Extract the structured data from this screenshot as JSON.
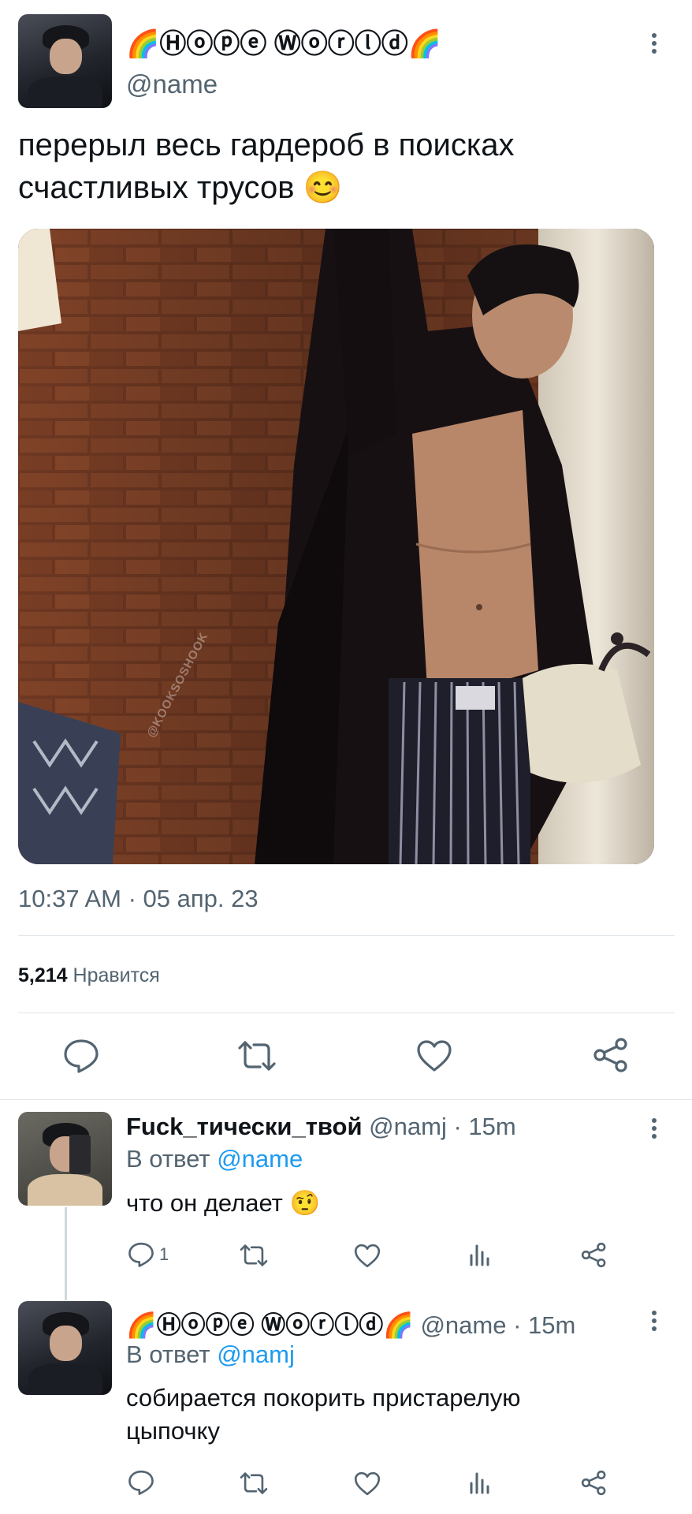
{
  "tweet": {
    "display_name": "🌈Ⓗⓞⓟⓔ Ⓦⓞⓡⓛⓓ🌈",
    "handle": "@name",
    "text_line1": "перерыл весь гардероб в поисках",
    "text_line2": "счастливых трусов 😊",
    "image_watermark": "@KOOKSOSHOOK",
    "timestamp": "10:37 AM · 05 апр. 23",
    "likes_count": "5,214",
    "likes_label": "Нравится"
  },
  "replies": [
    {
      "display_name": "Fuck_тически_твой",
      "handle": "@namj",
      "time": "· 15m",
      "reply_to_label": "В ответ",
      "reply_to_handle": "@name",
      "text_line1": "что он делает 🤨",
      "text_line2": "",
      "reply_count": "1"
    },
    {
      "display_name": "🌈Ⓗⓞⓟⓔ Ⓦⓞⓡⓛⓓ🌈",
      "handle": "@name",
      "time": "· 15m",
      "reply_to_label": "В ответ",
      "reply_to_handle": "@namj",
      "text_line1": "собирается покорить пристарелую",
      "text_line2": "цыпочку",
      "reply_count": ""
    }
  ],
  "icons": {
    "reply": "speech-bubble",
    "retweet": "retweet-arrows",
    "like": "heart",
    "views": "bar-chart",
    "share": "share-nodes",
    "more": "vertical-dots"
  },
  "colors": {
    "link": "#1d9bf0",
    "secondary_text": "#536471",
    "divider": "#e1e6ea"
  }
}
